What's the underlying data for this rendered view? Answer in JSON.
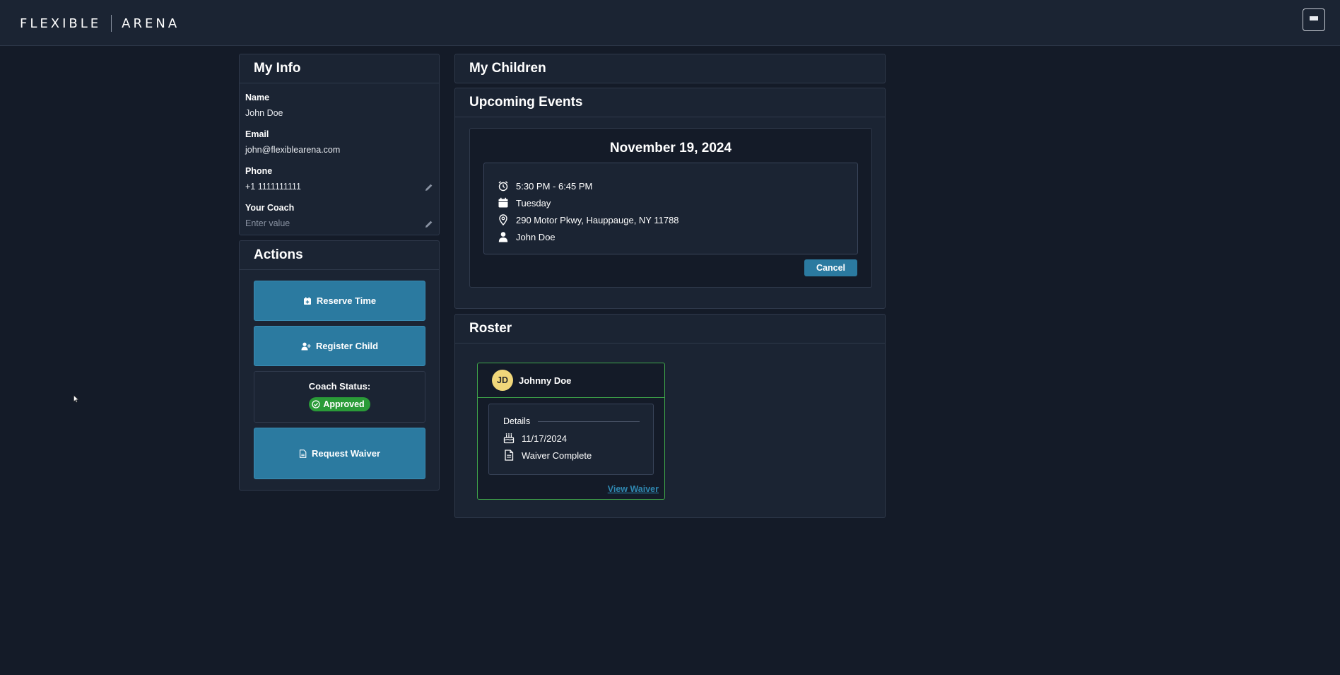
{
  "header": {
    "logo_left": "FLEXIBLE",
    "logo_right": "ARENA"
  },
  "my_info": {
    "title": "My Info",
    "name_label": "Name",
    "name_value": "John Doe",
    "email_label": "Email",
    "email_value": "john@flexiblearena.com",
    "phone_label": "Phone",
    "phone_value": "+1 1111111111",
    "coach_label": "Your Coach",
    "coach_placeholder": "Enter value"
  },
  "actions": {
    "title": "Actions",
    "reserve_label": "Reserve Time",
    "register_label": "Register Child",
    "coach_status_label": "Coach Status:",
    "coach_status_value": "Approved",
    "waiver_label": "Request Waiver"
  },
  "my_children": {
    "title": "My Children"
  },
  "upcoming_events": {
    "title": "Upcoming Events",
    "events": [
      {
        "date": "November 19, 2024",
        "time": "5:30 PM - 6:45 PM",
        "day": "Tuesday",
        "location": "290 Motor Pkwy, Hauppauge, NY 11788",
        "person": "John Doe",
        "cancel_label": "Cancel"
      }
    ]
  },
  "roster": {
    "title": "Roster",
    "children": [
      {
        "initials": "JD",
        "name": "Johnny Doe",
        "details_label": "Details",
        "birthdate": "11/17/2024",
        "waiver_status": "Waiver Complete",
        "view_waiver_label": "View Waiver"
      }
    ]
  },
  "colors": {
    "background": "#141b28",
    "panel": "#1b2433",
    "primary_button": "#2b7aa0",
    "approved_badge": "#2a9b38",
    "avatar": "#f1d77a",
    "roster_card_border": "#3fa64a"
  }
}
